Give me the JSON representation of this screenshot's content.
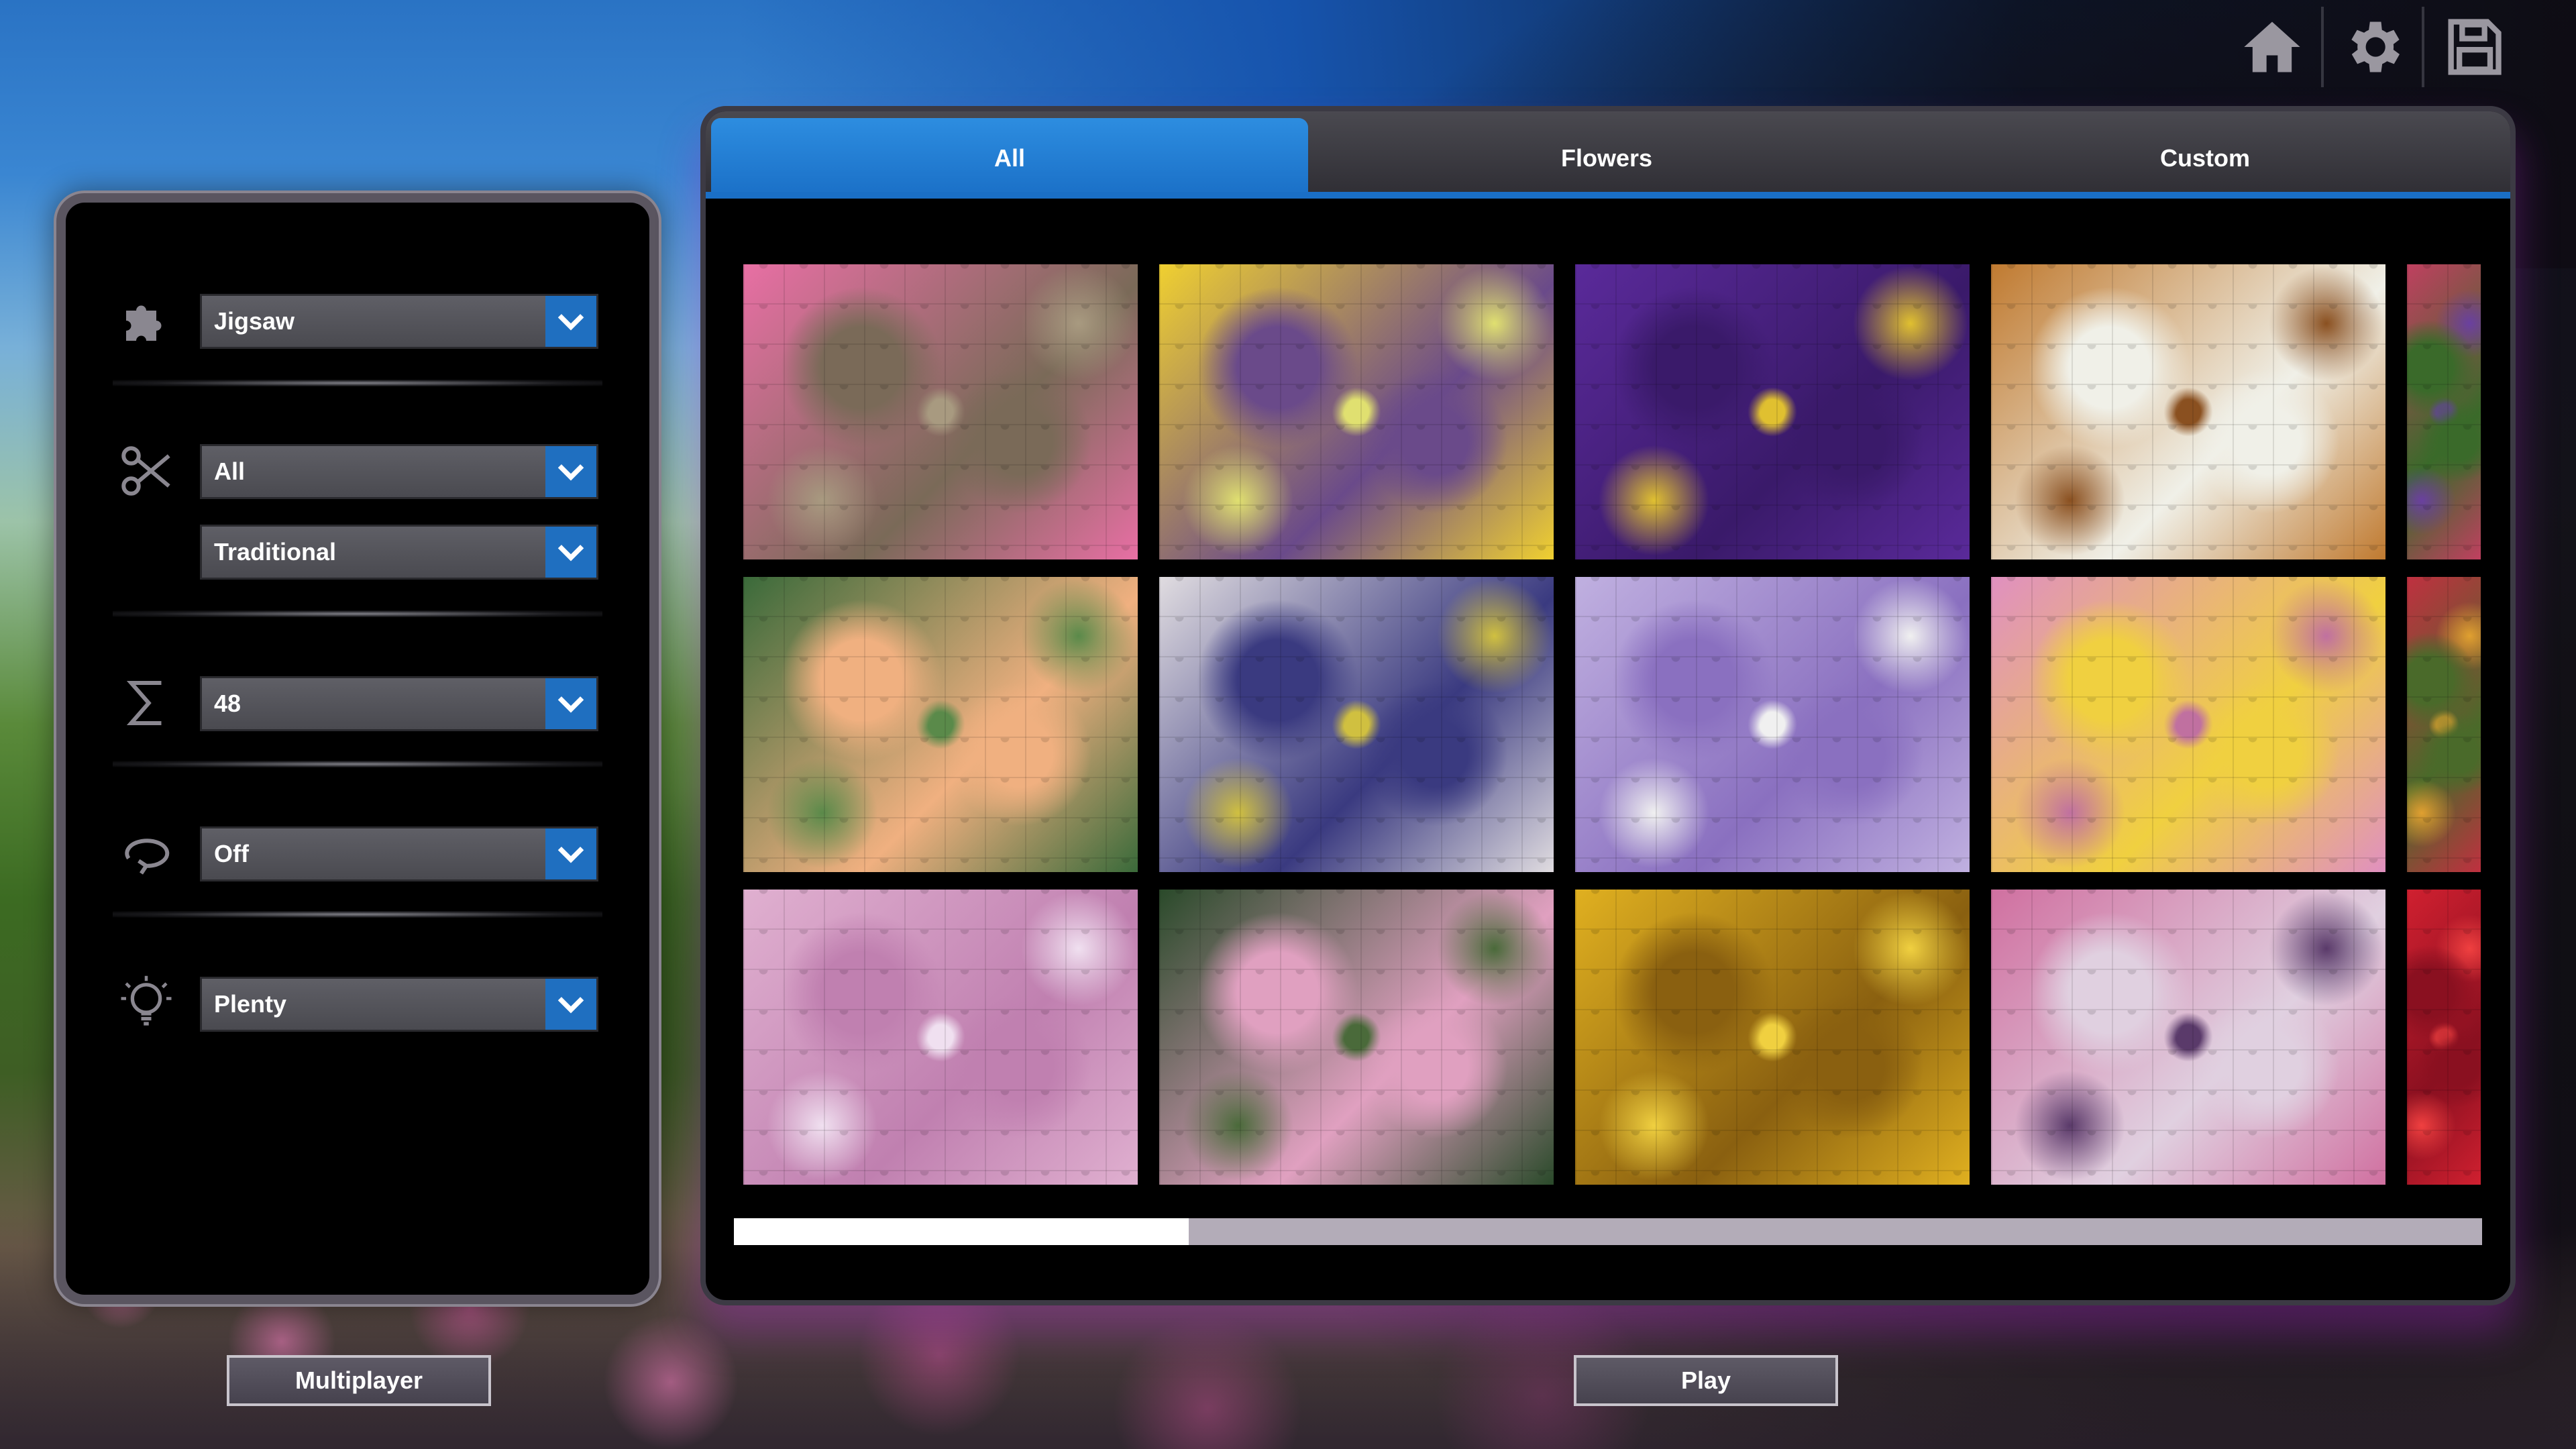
{
  "top_icons": [
    {
      "name": "home-icon"
    },
    {
      "name": "gear-icon"
    },
    {
      "name": "save-icon"
    }
  ],
  "settings": {
    "puzzle_type": {
      "icon": "puzzle-piece-icon",
      "value": "Jigsaw"
    },
    "cut_mode": {
      "icon": "scissors-icon",
      "value": "All"
    },
    "cut_style": {
      "value": "Traditional"
    },
    "piece_count": {
      "icon": "sigma-icon",
      "value": "48"
    },
    "rotation": {
      "icon": "rotate-icon",
      "value": "Off"
    },
    "hints": {
      "icon": "lightbulb-icon",
      "value": "Plenty"
    }
  },
  "tabs": [
    {
      "label": "All",
      "active": true
    },
    {
      "label": "Flowers",
      "active": false
    },
    {
      "label": "Custom",
      "active": false
    }
  ],
  "thumbnails": [
    {
      "name": "pink-lilies-on-pebbles",
      "colors": [
        "#e86fa4",
        "#7a6a58",
        "#a89a80"
      ]
    },
    {
      "name": "yellow-purple-flower-field",
      "colors": [
        "#f0d030",
        "#6a4a8a",
        "#e0e070"
      ]
    },
    {
      "name": "purple-asters",
      "colors": [
        "#5a2a9a",
        "#3a1a6a",
        "#e0c030"
      ]
    },
    {
      "name": "white-blossoms-on-orange",
      "colors": [
        "#c07a30",
        "#f0f0e8",
        "#8a5020"
      ]
    },
    {
      "name": "partial-flower-edge",
      "colors": [
        "#c04060",
        "#3a6a2a",
        "#6a40a0"
      ]
    },
    {
      "name": "frangipani-on-leaves",
      "colors": [
        "#3a6a3a",
        "#f0b080",
        "#5a8a4a"
      ]
    },
    {
      "name": "white-daisy-closeup",
      "colors": [
        "#e0dce0",
        "#3a3a80",
        "#d0c040"
      ]
    },
    {
      "name": "purple-white-asters",
      "colors": [
        "#c0b0e0",
        "#8a70c0",
        "#f0f0f0"
      ]
    },
    {
      "name": "pink-daisies",
      "colors": [
        "#e090c0",
        "#f0d040",
        "#c070a0"
      ]
    },
    {
      "name": "partial-red-flowers-edge",
      "colors": [
        "#c03040",
        "#4a6a2a",
        "#e0a030"
      ]
    },
    {
      "name": "pink-chrysanthemums",
      "colors": [
        "#e0b0d0",
        "#c080b0",
        "#f0e0f0"
      ]
    },
    {
      "name": "pink-peony-leaves",
      "colors": [
        "#2a4a2a",
        "#e0a0c0",
        "#4a6a3a"
      ]
    },
    {
      "name": "bee-on-sunflower",
      "colors": [
        "#e0b020",
        "#8a6010",
        "#f0d040"
      ]
    },
    {
      "name": "pink-rose-bouquet",
      "colors": [
        "#d070a0",
        "#e0d0e0",
        "#5a3a6a"
      ]
    },
    {
      "name": "partial-red-dahlia-edge",
      "colors": [
        "#d02030",
        "#8a1020",
        "#f04040"
      ]
    }
  ],
  "scroll_progress": 0.26,
  "buttons": {
    "multiplayer": "Multiplayer",
    "play": "Play"
  }
}
